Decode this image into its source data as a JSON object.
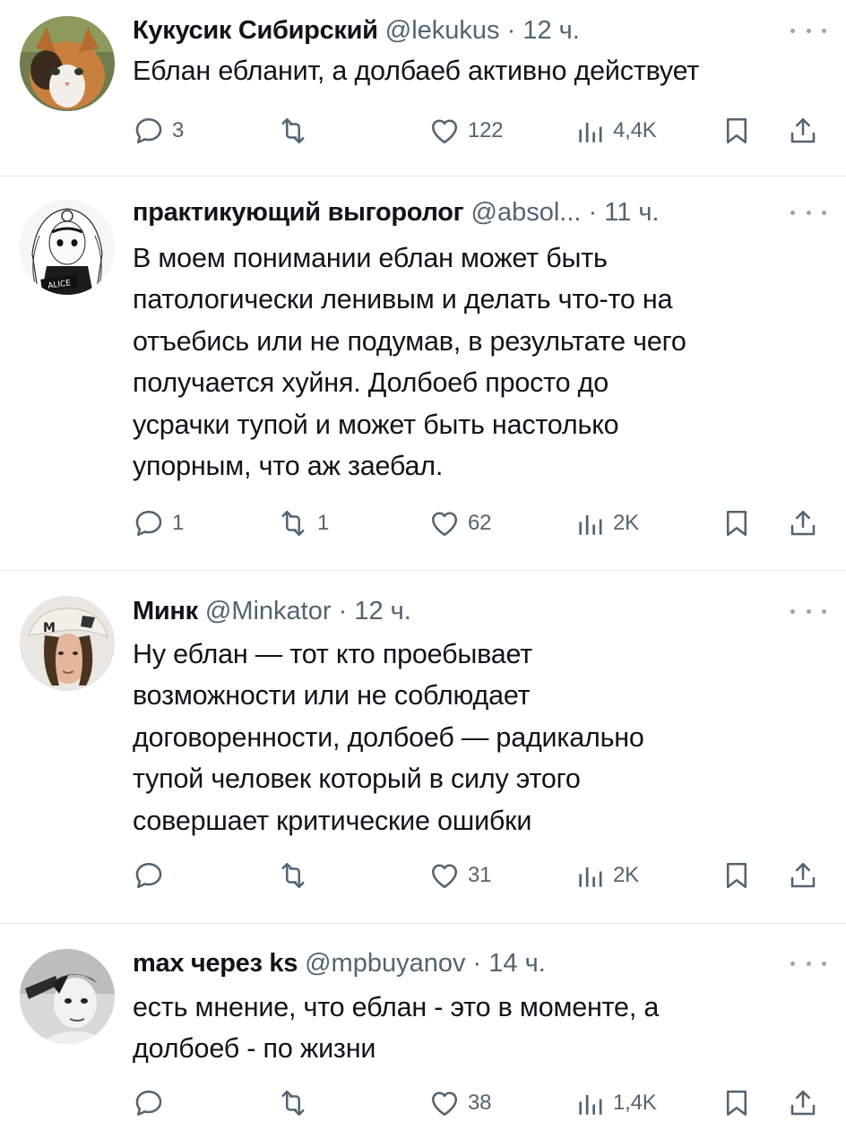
{
  "tweets": [
    {
      "name": "Кукусик Сибирский",
      "handle": "@lekukus",
      "dot": "·",
      "time": "12 ч.",
      "text": "Еблан ебланит, а долбаеб активно действует",
      "replies": "3",
      "retweets": "",
      "likes": "122",
      "views": "4,4K",
      "avatar": "cat-photo"
    },
    {
      "name": "практикующий выгоролог",
      "handle": "@absol...",
      "dot": "·",
      "time": "11 ч.",
      "text": "В моем понимании еблан может быть\nпатологически ленивым и делать что-то на\nотъебись или не подумав, в результате чего\nполучается хуйня. Долбоеб просто до\nусрачки тупой и может быть настолько\nупорным, что аж заебал.",
      "replies": "1",
      "retweets": "1",
      "likes": "62",
      "views": "2K",
      "avatar": "anime-drawing",
      "avatar_text": "ALICE"
    },
    {
      "name": "Минк",
      "handle": "@Minkator",
      "dot": "·",
      "time": "12 ч.",
      "text": "Ну еблан — тот кто проебывает\nвозможности или не соблюдает\nдоговоренности, долбоеб — радикально\nтупой человек который в силу этого\nсовершает критические ошибки",
      "replies": "",
      "retweets": "",
      "likes": "31",
      "views": "2K",
      "avatar": "person-with-cap"
    },
    {
      "name": "max через ks",
      "handle": "@mpbuyanov",
      "dot": "·",
      "time": "14 ч.",
      "text": "есть мнение, что еблан - это в моменте, а\nдолбоеб - по жизни",
      "replies": "",
      "retweets": "",
      "likes": "38",
      "views": "1,4K",
      "avatar": "bw-portrait"
    }
  ],
  "icons": {
    "reply": "speech-bubble-icon",
    "retweet": "retweet-arrows-icon",
    "like": "heart-icon",
    "views": "bar-chart-icon",
    "bookmark": "bookmark-icon",
    "share": "share-upload-icon",
    "more": "ellipsis-icon"
  },
  "colors": {
    "text": "#0f1419",
    "secondary": "#536471",
    "divider": "#e6e9eb"
  }
}
